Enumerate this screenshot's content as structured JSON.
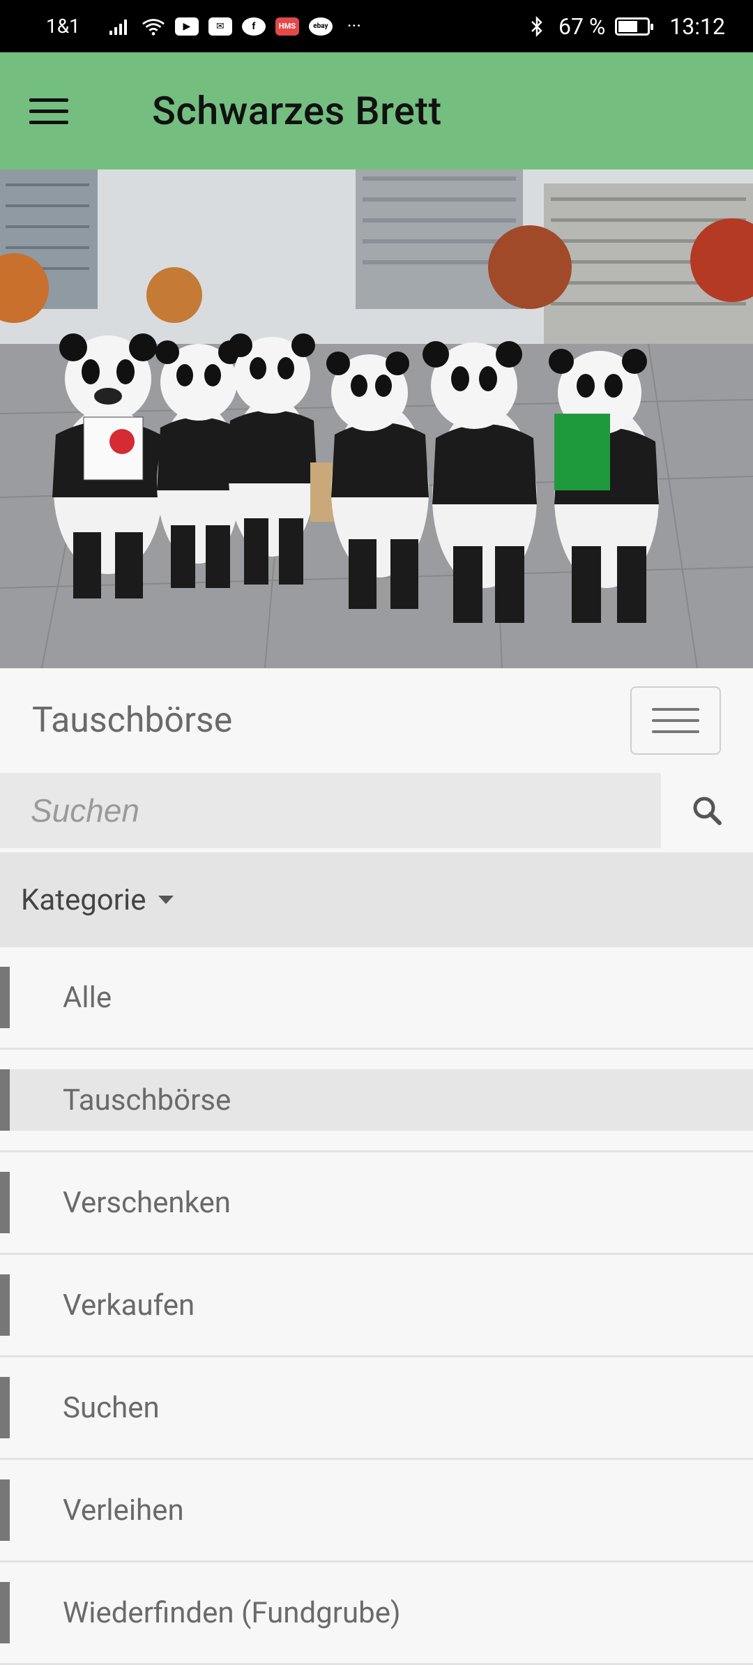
{
  "status_bar": {
    "carrier": "1&1",
    "battery": "67 %",
    "battery_level": 0.67,
    "time": "13:12",
    "icons": [
      "signal-icon",
      "wifi-icon",
      "youtube-icon",
      "mail-icon",
      "facebook-icon",
      "hms-icon",
      "ebay-icon",
      "more-icon",
      "bluetooth-icon",
      "battery-icon"
    ]
  },
  "app_bar": {
    "title": "Schwarzes Brett",
    "menu_icon": "hamburger-menu-icon",
    "background": "#74bf80"
  },
  "hero": {
    "description_alt": "panda-costumes-photo"
  },
  "section": {
    "title": "Tauschbörse",
    "toggle_icon": "hamburger-menu-icon"
  },
  "search": {
    "placeholder": "Suchen",
    "icon": "search-icon"
  },
  "category": {
    "label": "Kategorie",
    "items": [
      {
        "label": "Alle",
        "active": false
      },
      {
        "label": "Tauschbörse",
        "active": true
      },
      {
        "label": "Verschenken",
        "active": false
      },
      {
        "label": "Verkaufen",
        "active": false
      },
      {
        "label": "Suchen",
        "active": false
      },
      {
        "label": "Verleihen",
        "active": false
      },
      {
        "label": "Wiederfinden (Fundgrube)",
        "active": false
      }
    ]
  }
}
